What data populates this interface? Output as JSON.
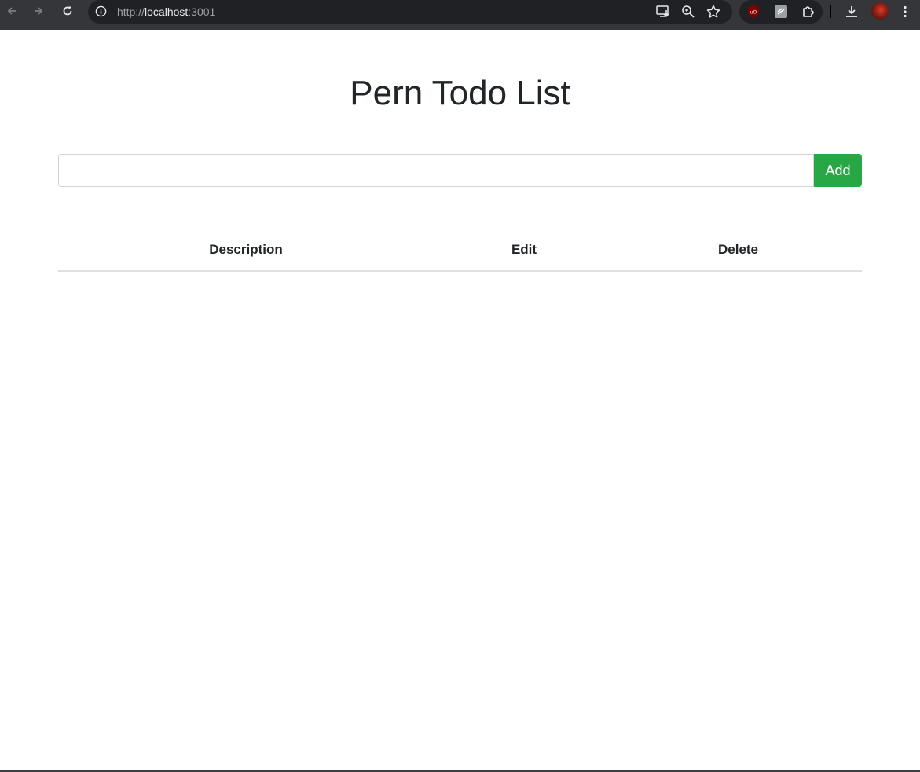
{
  "browser": {
    "url_scheme": "http://",
    "url_host": "localhost",
    "url_port": ":3001"
  },
  "page": {
    "title": "Pern Todo List"
  },
  "todo_form": {
    "input_value": "",
    "add_label": "Add"
  },
  "table": {
    "headers": [
      "Description",
      "Edit",
      "Delete"
    ]
  },
  "colors": {
    "accent": "#28a745",
    "text": "#212529",
    "chrome_bar": "#35363a"
  }
}
